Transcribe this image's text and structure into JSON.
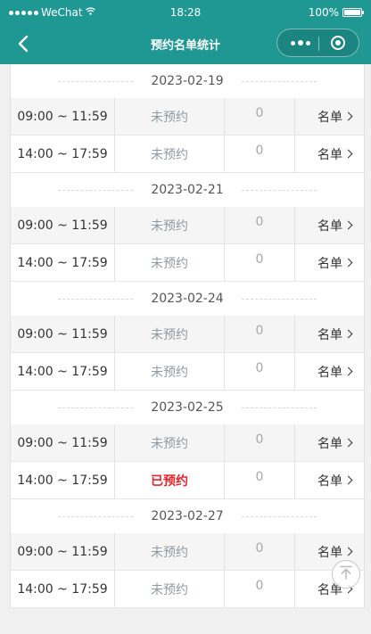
{
  "status_bar": {
    "carrier": "WeChat",
    "time": "18:28",
    "battery": "100%"
  },
  "nav": {
    "title": "预约名单统计"
  },
  "groups": [
    {
      "date": "2023-02-19",
      "rows": [
        {
          "time": "09:00 ~ 11:59",
          "status": "未预约",
          "count": "0",
          "list": "名单"
        },
        {
          "time": "14:00 ~ 17:59",
          "status": "未预约",
          "count": "0",
          "list": "名单"
        }
      ]
    },
    {
      "date": "2023-02-21",
      "rows": [
        {
          "time": "09:00 ~ 11:59",
          "status": "未预约",
          "count": "0",
          "list": "名单"
        },
        {
          "time": "14:00 ~ 17:59",
          "status": "未预约",
          "count": "0",
          "list": "名单"
        }
      ]
    },
    {
      "date": "2023-02-24",
      "rows": [
        {
          "time": "09:00 ~ 11:59",
          "status": "未预约",
          "count": "0",
          "list": "名单"
        },
        {
          "time": "14:00 ~ 17:59",
          "status": "未预约",
          "count": "0",
          "list": "名单"
        }
      ]
    },
    {
      "date": "2023-02-25",
      "rows": [
        {
          "time": "09:00 ~ 11:59",
          "status": "未预约",
          "count": "0",
          "list": "名单"
        },
        {
          "time": "14:00 ~ 17:59",
          "status": "已预约",
          "count": "0",
          "list": "名单"
        }
      ]
    },
    {
      "date": "2023-02-27",
      "rows": [
        {
          "time": "09:00 ~ 11:59",
          "status": "未预约",
          "count": "0",
          "list": "名单"
        },
        {
          "time": "14:00 ~ 17:59",
          "status": "未预约",
          "count": "0",
          "list": "名单"
        }
      ]
    }
  ],
  "colors": {
    "brand": "#1f9894",
    "booked": "#e8252d",
    "unbooked": "#8e9aa4"
  },
  "icons": [
    "back-icon",
    "more-icon",
    "home-icon",
    "chevron-right-icon",
    "back-to-top-icon"
  ]
}
